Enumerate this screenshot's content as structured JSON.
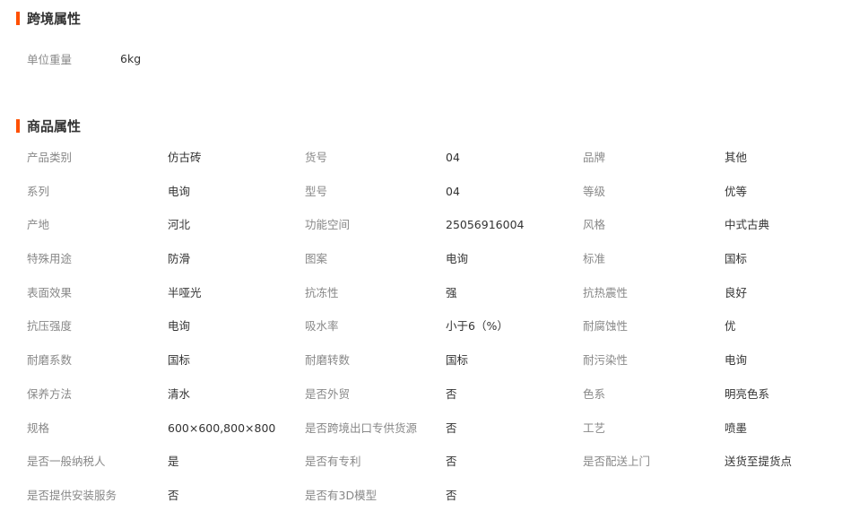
{
  "cross_border": {
    "title": "跨境属性",
    "items": [
      {
        "label": "单位重量",
        "value": "6kg"
      }
    ]
  },
  "product_attrs": {
    "title": "商品属性",
    "rows": [
      [
        {
          "label": "产品类别",
          "value": "仿古砖"
        },
        {
          "label": "货号",
          "value": "04"
        },
        {
          "label": "品牌",
          "value": "其他"
        }
      ],
      [
        {
          "label": "系列",
          "value": "电询"
        },
        {
          "label": "型号",
          "value": "04"
        },
        {
          "label": "等级",
          "value": "优等"
        }
      ],
      [
        {
          "label": "产地",
          "value": "河北"
        },
        {
          "label": "功能空间",
          "value": "25056916004"
        },
        {
          "label": "风格",
          "value": "中式古典"
        }
      ],
      [
        {
          "label": "特殊用途",
          "value": "防滑"
        },
        {
          "label": "图案",
          "value": "电询"
        },
        {
          "label": "标准",
          "value": "国标"
        }
      ],
      [
        {
          "label": "表面效果",
          "value": "半哑光"
        },
        {
          "label": "抗冻性",
          "value": "强"
        },
        {
          "label": "抗热震性",
          "value": "良好"
        }
      ],
      [
        {
          "label": "抗压强度",
          "value": "电询"
        },
        {
          "label": "吸水率",
          "value": "小于6（%）"
        },
        {
          "label": "耐腐蚀性",
          "value": "优"
        }
      ],
      [
        {
          "label": "耐磨系数",
          "value": "国标"
        },
        {
          "label": "耐磨转数",
          "value": "国标"
        },
        {
          "label": "耐污染性",
          "value": "电询"
        }
      ],
      [
        {
          "label": "保养方法",
          "value": "清水"
        },
        {
          "label": "是否外贸",
          "value": "否"
        },
        {
          "label": "色系",
          "value": "明亮色系"
        }
      ],
      [
        {
          "label": "规格",
          "value": "600×600,800×800"
        },
        {
          "label": "是否跨境出口专供货源",
          "value": "否"
        },
        {
          "label": "工艺",
          "value": "喷墨"
        }
      ],
      [
        {
          "label": "是否一般纳税人",
          "value": "是"
        },
        {
          "label": "是否有专利",
          "value": "否"
        },
        {
          "label": "是否配送上门",
          "value": "送货至提货点"
        }
      ],
      [
        {
          "label": "是否提供安装服务",
          "value": "否"
        },
        {
          "label": "是否有3D模型",
          "value": "否"
        }
      ]
    ]
  },
  "colors": {
    "accent_bar": "#ff5000",
    "label_text": "#888888",
    "value_text": "#333333"
  }
}
